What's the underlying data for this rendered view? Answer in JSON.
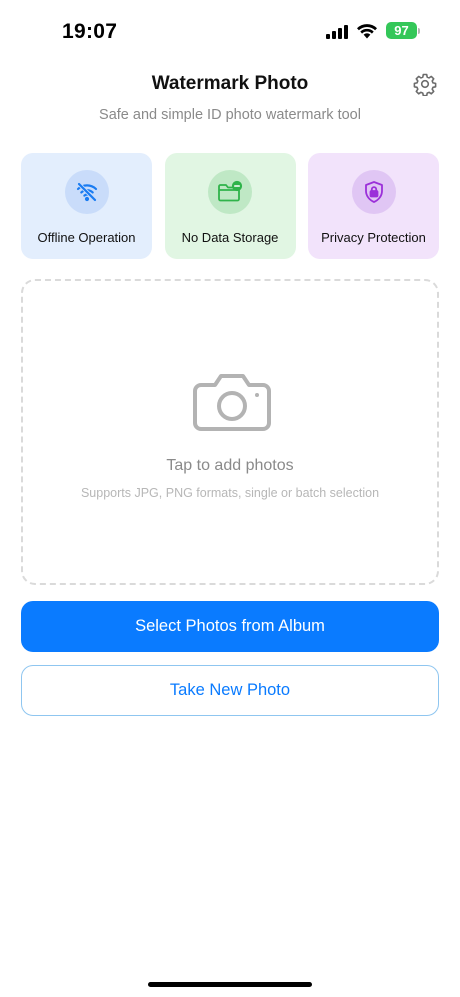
{
  "status_bar": {
    "time": "19:07",
    "battery": "97",
    "battery_color": "#34c759"
  },
  "header": {
    "title": "Watermark Photo",
    "subtitle": "Safe and simple ID photo watermark tool",
    "settings_icon": "gear-icon"
  },
  "features": [
    {
      "label": "Offline Operation",
      "icon": "wifi-off-icon",
      "color": "#1a7cf2"
    },
    {
      "label": "No Data Storage",
      "icon": "folder-minus-icon",
      "color": "#2fb34a"
    },
    {
      "label": "Privacy Protection",
      "icon": "lock-shield-icon",
      "color": "#9b30d9"
    }
  ],
  "drop_zone": {
    "title": "Tap to add photos",
    "hint": "Supports JPG, PNG formats, single or batch selection",
    "icon": "camera-icon"
  },
  "actions": {
    "select_album_label": "Select Photos from Album",
    "take_photo_label": "Take New Photo",
    "primary_color": "#0a7bff"
  }
}
